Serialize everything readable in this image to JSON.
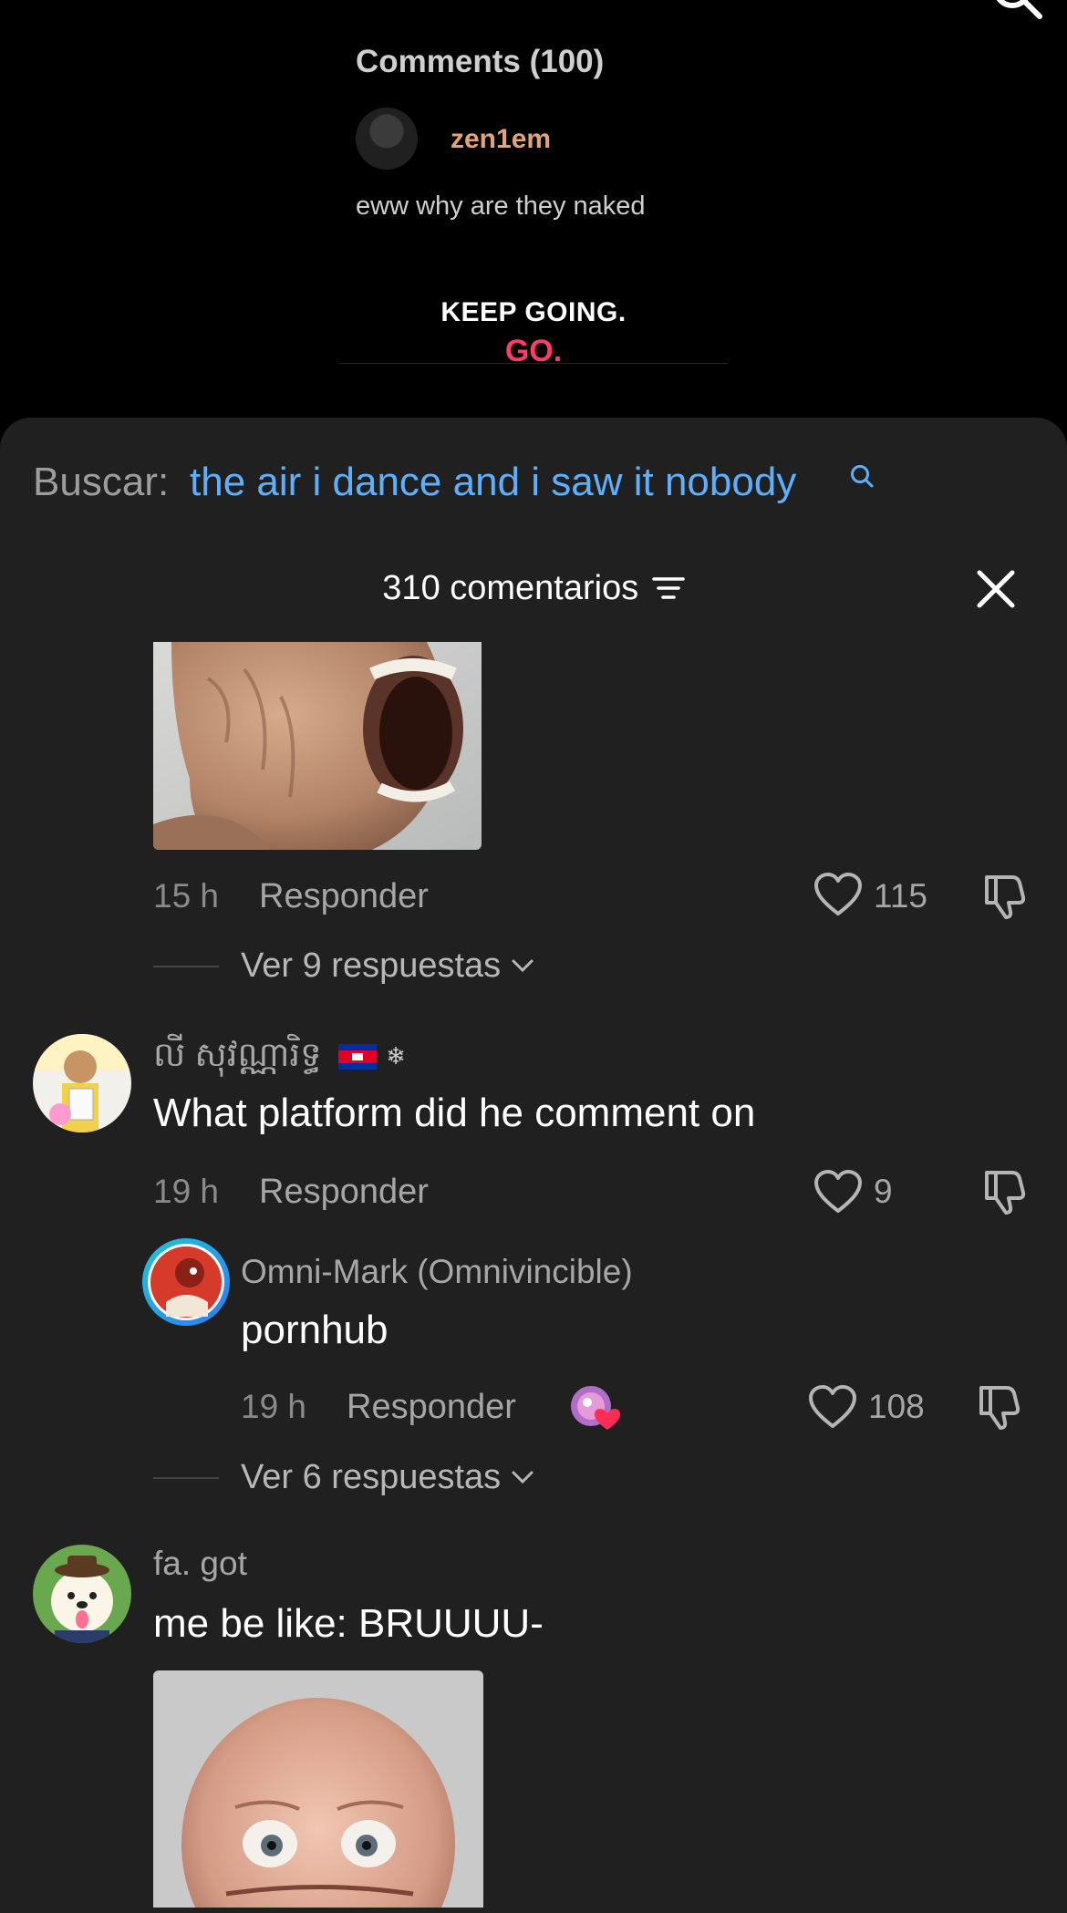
{
  "video": {
    "comments_title": "Comments (100)",
    "user": "zen1em",
    "text": "eww why are they naked",
    "keep_line1": "KEEP GOING.",
    "keep_line2": "GO."
  },
  "search": {
    "label": "Buscar:",
    "query": "the air i dance and i saw it nobody"
  },
  "header": {
    "count": "310 comentarios"
  },
  "comments": [
    {
      "time": "15 h",
      "reply": "Responder",
      "likes": "115",
      "view_replies": "Ver 9 respuestas"
    },
    {
      "user": "លី សុវណ្ណារិទ្ធ",
      "text": "What platform did he comment on",
      "time": "19 h",
      "reply": "Responder",
      "likes": "9",
      "subreply": {
        "user": "Omni-Mark (Omnivincible)",
        "text": "pornhub",
        "time": "19 h",
        "reply": "Responder",
        "likes": "108"
      },
      "view_replies": "Ver 6 respuestas"
    },
    {
      "user": "fa. got",
      "text": "me be like: BRUUUU-"
    }
  ],
  "colors": {
    "accent": "#5eb0ff",
    "keep_go": "#ff3b6b",
    "sheet_bg": "#202020",
    "overlay_user": "#e2a377"
  }
}
